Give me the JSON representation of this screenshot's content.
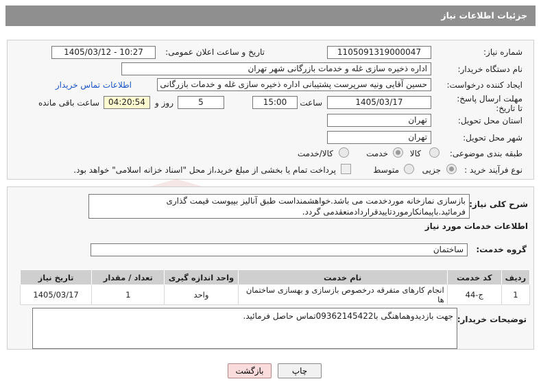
{
  "window": {
    "title": "جزئیات اطلاعات نیاز"
  },
  "form": {
    "need_number_label": "شماره نیاز:",
    "need_number": "1105091319000047",
    "announce_label": "تاریخ و ساعت اعلان عمومی:",
    "announce_value": "1405/03/12 - 10:27",
    "buyer_org_label": "نام دستگاه خریدار:",
    "buyer_org": "اداره ذخیره سازی غله و خدمات بازرگانی شهر تهران",
    "creator_label": "ایجاد کننده درخواست:",
    "creator": "حسین آقایی ونیه سرپرست پشتیبانی اداره ذخیره سازی غله و خدمات بازرگانی",
    "contact_link": "اطلاعات تماس خریدار",
    "deadline_label": "مهلت ارسال پاسخ: تا تاریخ:",
    "deadline_date": "1405/03/17",
    "time_label": "ساعت",
    "deadline_time": "15:00",
    "days_value": "5",
    "days_label": "روز و",
    "remaining_time": "04:20:54",
    "remaining_label": "ساعت باقی مانده",
    "province_label": "استان محل تحویل:",
    "province": "تهران",
    "city_label": "شهر محل تحویل:",
    "city": "تهران",
    "category_label": "طبقه بندی موضوعی:",
    "category_options": [
      "کالا",
      "خدمت",
      "کالا/خدمت"
    ],
    "category_selected": "خدمت",
    "purchase_type_label": "نوع فرآیند خرید :",
    "purchase_options": [
      "جزیی",
      "متوسط"
    ],
    "purchase_selected": "جزیی",
    "payment_note": "پرداخت تمام یا بخشی از مبلغ خرید،از محل \"اسناد خزانه اسلامی\" خواهد بود."
  },
  "description": {
    "label": "شرح کلی نیاز:",
    "text": "بازسازی نمازخانه موردخدمت می باشد.خواهشمنداست طبق آنالیز بپیوست قیمت گذاری فرمائید.باپیمانکارموردتاییدقراردادمنعقدمی گردد."
  },
  "services": {
    "section_title": "اطلاعات خدمات مورد نیاز",
    "group_label": "گروه خدمت:",
    "group_value": "ساختمان",
    "columns": [
      "ردیف",
      "کد خدمت",
      "نام خدمت",
      "واحد اندازه گیری",
      "تعداد / مقدار",
      "تاریخ نیاز"
    ],
    "rows": [
      [
        "1",
        "ج-44",
        "انجام کارهای متفرقه درخصوص بازسازی و بهسازی ساختمان ها",
        "واحد",
        "1",
        "1405/03/17"
      ]
    ]
  },
  "buyer_notes": {
    "label": "توضیحات خریدار:",
    "text": "جهت بازدیدوهماهنگی با09362145422تماس حاصل فرمائید."
  },
  "buttons": {
    "print": "چاپ",
    "back": "بازگشت"
  },
  "watermark": {
    "text": "AriaTender.net"
  }
}
